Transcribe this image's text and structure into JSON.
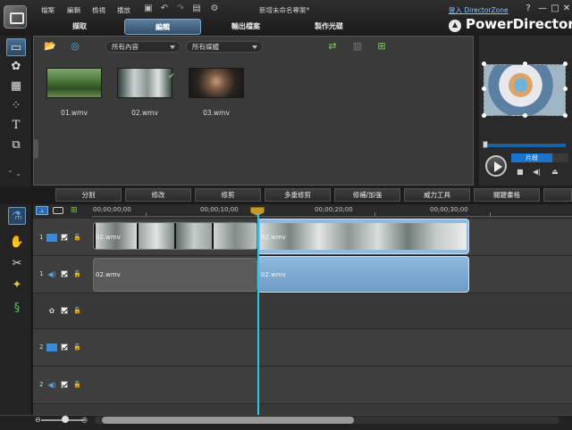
{
  "window": {
    "project_title": "新增未命名專案*",
    "login_link": "登入 DirectorZone",
    "controls": [
      "?",
      "—",
      "□",
      "✕"
    ]
  },
  "menu": {
    "items": [
      "檔案",
      "編輯",
      "檢視",
      "播放"
    ]
  },
  "modes": {
    "tabs": [
      "擷取",
      "編輯",
      "輸出檔案",
      "製作光碟"
    ],
    "active": "編輯"
  },
  "brand": {
    "name": "PowerDirector"
  },
  "library": {
    "filter_content": "所有內容",
    "filter_media": "所有媒體",
    "files": [
      {
        "name": "01.wmv"
      },
      {
        "name": "02.wmv"
      },
      {
        "name": "03.wmv"
      }
    ]
  },
  "preview": {
    "mode_clip": "片段"
  },
  "edit_toolbar": {
    "buttons": [
      "分割",
      "修改",
      "修剪",
      "多重修剪",
      "修補/加強",
      "威力工具",
      "關鍵畫格"
    ]
  },
  "timeline": {
    "ruler": [
      "00;00;00;00",
      "00;00;10;00",
      "00;00;20;00",
      "00;00;30;00"
    ],
    "tracks": [
      {
        "num": "1",
        "type": "video",
        "icon": "video-track-icon"
      },
      {
        "num": "1",
        "type": "audio",
        "icon": "audio-track-icon"
      },
      {
        "num": "",
        "type": "fx",
        "icon": "effect-track-icon"
      },
      {
        "num": "2",
        "type": "video",
        "icon": "video-track-icon"
      },
      {
        "num": "2",
        "type": "audio",
        "icon": "audio-track-icon"
      }
    ],
    "clips": {
      "v1_a": "02.wmv",
      "v1_b": "02.wmv",
      "a1_a": "02.wmv",
      "a1_b": "02.wmv"
    }
  },
  "colors": {
    "accent": "#1e73c8",
    "playhead": "#29c7e8",
    "clip_selected": "#8fb9dd"
  }
}
